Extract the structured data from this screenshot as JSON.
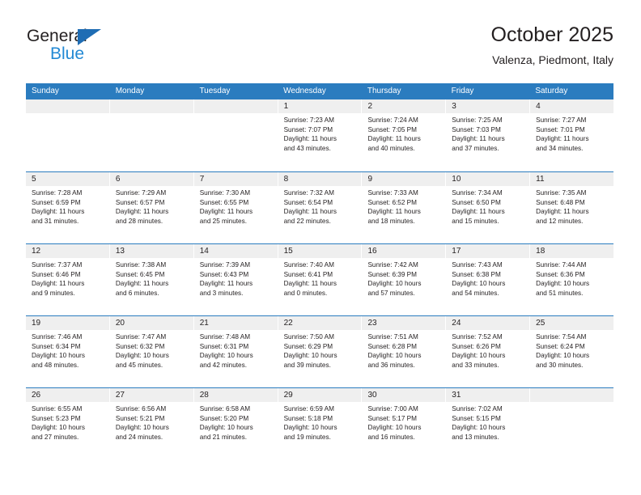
{
  "brand": {
    "name_part1": "General",
    "name_part2": "Blue",
    "triangle_icon": "brand-triangle-icon",
    "color_dark": "#231f20",
    "color_blue": "#2389d4",
    "color_triangle": "#1f6db4"
  },
  "header": {
    "title": "October 2025",
    "subtitle": "Valenza, Piedmont, Italy"
  },
  "theme": {
    "header_blue": "#2b7cbf",
    "date_band_gray": "#efefef",
    "text": "#231f20"
  },
  "calendar": {
    "day_headers": [
      "Sunday",
      "Monday",
      "Tuesday",
      "Wednesday",
      "Thursday",
      "Friday",
      "Saturday"
    ],
    "weeks": [
      [
        {
          "day": "",
          "empty": true
        },
        {
          "day": "",
          "empty": true
        },
        {
          "day": "",
          "empty": true
        },
        {
          "day": "1",
          "sunrise": "Sunrise: 7:23 AM",
          "sunset": "Sunset: 7:07 PM",
          "daylight_line1": "Daylight: 11 hours",
          "daylight_line2": "and 43 minutes."
        },
        {
          "day": "2",
          "sunrise": "Sunrise: 7:24 AM",
          "sunset": "Sunset: 7:05 PM",
          "daylight_line1": "Daylight: 11 hours",
          "daylight_line2": "and 40 minutes."
        },
        {
          "day": "3",
          "sunrise": "Sunrise: 7:25 AM",
          "sunset": "Sunset: 7:03 PM",
          "daylight_line1": "Daylight: 11 hours",
          "daylight_line2": "and 37 minutes."
        },
        {
          "day": "4",
          "sunrise": "Sunrise: 7:27 AM",
          "sunset": "Sunset: 7:01 PM",
          "daylight_line1": "Daylight: 11 hours",
          "daylight_line2": "and 34 minutes."
        }
      ],
      [
        {
          "day": "5",
          "sunrise": "Sunrise: 7:28 AM",
          "sunset": "Sunset: 6:59 PM",
          "daylight_line1": "Daylight: 11 hours",
          "daylight_line2": "and 31 minutes."
        },
        {
          "day": "6",
          "sunrise": "Sunrise: 7:29 AM",
          "sunset": "Sunset: 6:57 PM",
          "daylight_line1": "Daylight: 11 hours",
          "daylight_line2": "and 28 minutes."
        },
        {
          "day": "7",
          "sunrise": "Sunrise: 7:30 AM",
          "sunset": "Sunset: 6:55 PM",
          "daylight_line1": "Daylight: 11 hours",
          "daylight_line2": "and 25 minutes."
        },
        {
          "day": "8",
          "sunrise": "Sunrise: 7:32 AM",
          "sunset": "Sunset: 6:54 PM",
          "daylight_line1": "Daylight: 11 hours",
          "daylight_line2": "and 22 minutes."
        },
        {
          "day": "9",
          "sunrise": "Sunrise: 7:33 AM",
          "sunset": "Sunset: 6:52 PM",
          "daylight_line1": "Daylight: 11 hours",
          "daylight_line2": "and 18 minutes."
        },
        {
          "day": "10",
          "sunrise": "Sunrise: 7:34 AM",
          "sunset": "Sunset: 6:50 PM",
          "daylight_line1": "Daylight: 11 hours",
          "daylight_line2": "and 15 minutes."
        },
        {
          "day": "11",
          "sunrise": "Sunrise: 7:35 AM",
          "sunset": "Sunset: 6:48 PM",
          "daylight_line1": "Daylight: 11 hours",
          "daylight_line2": "and 12 minutes."
        }
      ],
      [
        {
          "day": "12",
          "sunrise": "Sunrise: 7:37 AM",
          "sunset": "Sunset: 6:46 PM",
          "daylight_line1": "Daylight: 11 hours",
          "daylight_line2": "and 9 minutes."
        },
        {
          "day": "13",
          "sunrise": "Sunrise: 7:38 AM",
          "sunset": "Sunset: 6:45 PM",
          "daylight_line1": "Daylight: 11 hours",
          "daylight_line2": "and 6 minutes."
        },
        {
          "day": "14",
          "sunrise": "Sunrise: 7:39 AM",
          "sunset": "Sunset: 6:43 PM",
          "daylight_line1": "Daylight: 11 hours",
          "daylight_line2": "and 3 minutes."
        },
        {
          "day": "15",
          "sunrise": "Sunrise: 7:40 AM",
          "sunset": "Sunset: 6:41 PM",
          "daylight_line1": "Daylight: 11 hours",
          "daylight_line2": "and 0 minutes."
        },
        {
          "day": "16",
          "sunrise": "Sunrise: 7:42 AM",
          "sunset": "Sunset: 6:39 PM",
          "daylight_line1": "Daylight: 10 hours",
          "daylight_line2": "and 57 minutes."
        },
        {
          "day": "17",
          "sunrise": "Sunrise: 7:43 AM",
          "sunset": "Sunset: 6:38 PM",
          "daylight_line1": "Daylight: 10 hours",
          "daylight_line2": "and 54 minutes."
        },
        {
          "day": "18",
          "sunrise": "Sunrise: 7:44 AM",
          "sunset": "Sunset: 6:36 PM",
          "daylight_line1": "Daylight: 10 hours",
          "daylight_line2": "and 51 minutes."
        }
      ],
      [
        {
          "day": "19",
          "sunrise": "Sunrise: 7:46 AM",
          "sunset": "Sunset: 6:34 PM",
          "daylight_line1": "Daylight: 10 hours",
          "daylight_line2": "and 48 minutes."
        },
        {
          "day": "20",
          "sunrise": "Sunrise: 7:47 AM",
          "sunset": "Sunset: 6:32 PM",
          "daylight_line1": "Daylight: 10 hours",
          "daylight_line2": "and 45 minutes."
        },
        {
          "day": "21",
          "sunrise": "Sunrise: 7:48 AM",
          "sunset": "Sunset: 6:31 PM",
          "daylight_line1": "Daylight: 10 hours",
          "daylight_line2": "and 42 minutes."
        },
        {
          "day": "22",
          "sunrise": "Sunrise: 7:50 AM",
          "sunset": "Sunset: 6:29 PM",
          "daylight_line1": "Daylight: 10 hours",
          "daylight_line2": "and 39 minutes."
        },
        {
          "day": "23",
          "sunrise": "Sunrise: 7:51 AM",
          "sunset": "Sunset: 6:28 PM",
          "daylight_line1": "Daylight: 10 hours",
          "daylight_line2": "and 36 minutes."
        },
        {
          "day": "24",
          "sunrise": "Sunrise: 7:52 AM",
          "sunset": "Sunset: 6:26 PM",
          "daylight_line1": "Daylight: 10 hours",
          "daylight_line2": "and 33 minutes."
        },
        {
          "day": "25",
          "sunrise": "Sunrise: 7:54 AM",
          "sunset": "Sunset: 6:24 PM",
          "daylight_line1": "Daylight: 10 hours",
          "daylight_line2": "and 30 minutes."
        }
      ],
      [
        {
          "day": "26",
          "sunrise": "Sunrise: 6:55 AM",
          "sunset": "Sunset: 5:23 PM",
          "daylight_line1": "Daylight: 10 hours",
          "daylight_line2": "and 27 minutes."
        },
        {
          "day": "27",
          "sunrise": "Sunrise: 6:56 AM",
          "sunset": "Sunset: 5:21 PM",
          "daylight_line1": "Daylight: 10 hours",
          "daylight_line2": "and 24 minutes."
        },
        {
          "day": "28",
          "sunrise": "Sunrise: 6:58 AM",
          "sunset": "Sunset: 5:20 PM",
          "daylight_line1": "Daylight: 10 hours",
          "daylight_line2": "and 21 minutes."
        },
        {
          "day": "29",
          "sunrise": "Sunrise: 6:59 AM",
          "sunset": "Sunset: 5:18 PM",
          "daylight_line1": "Daylight: 10 hours",
          "daylight_line2": "and 19 minutes."
        },
        {
          "day": "30",
          "sunrise": "Sunrise: 7:00 AM",
          "sunset": "Sunset: 5:17 PM",
          "daylight_line1": "Daylight: 10 hours",
          "daylight_line2": "and 16 minutes."
        },
        {
          "day": "31",
          "sunrise": "Sunrise: 7:02 AM",
          "sunset": "Sunset: 5:15 PM",
          "daylight_line1": "Daylight: 10 hours",
          "daylight_line2": "and 13 minutes."
        },
        {
          "day": "",
          "empty": true
        }
      ]
    ]
  }
}
